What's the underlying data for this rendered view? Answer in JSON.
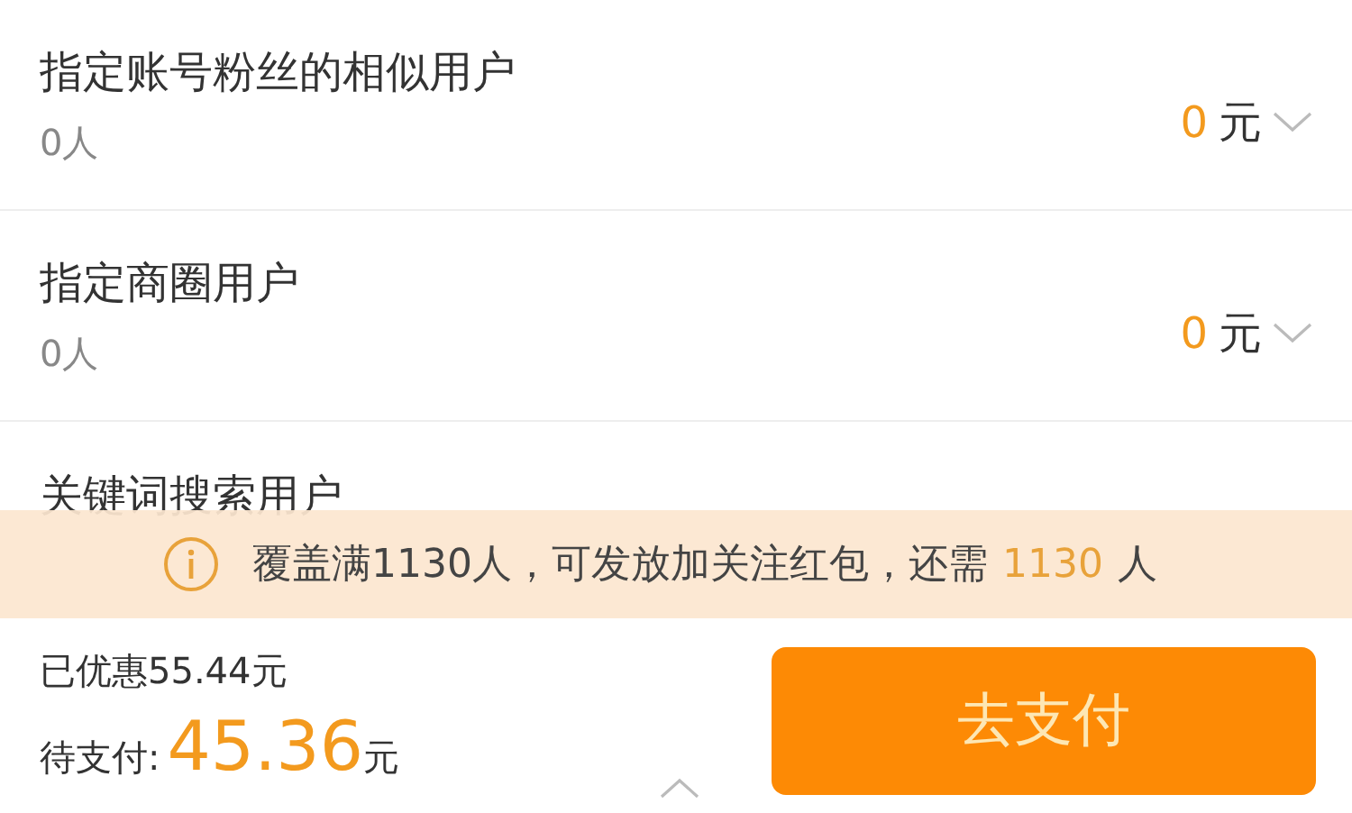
{
  "targets": [
    {
      "title": "指定账号粉丝的相似用户",
      "count": "0人",
      "amount": "0",
      "unit": "元"
    },
    {
      "title": "指定商圈用户",
      "count": "0人",
      "amount": "0",
      "unit": "元"
    },
    {
      "title": "关键词搜索用户"
    }
  ],
  "notice": {
    "text": "覆盖满1130人，可发放加关注红包，还需",
    "count": "1130",
    "unit": "人"
  },
  "footer": {
    "discount": "已优惠55.44元",
    "pay_label": "待支付:",
    "amount": "45.36",
    "unit": "元",
    "button": "去支付"
  }
}
